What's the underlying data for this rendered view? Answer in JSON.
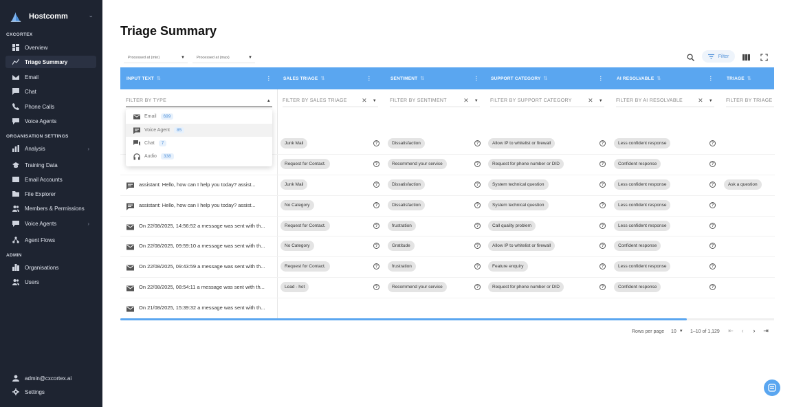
{
  "app": {
    "name": "Hostcomm"
  },
  "sidebar": {
    "sections": {
      "cxcortex": "CXCORTEX",
      "org": "ORGANISATION SETTINGS",
      "admin": "ADMIN"
    },
    "items": [
      {
        "label": "Overview",
        "icon": "dashboard-icon"
      },
      {
        "label": "Triage Summary",
        "icon": "triage-icon"
      },
      {
        "label": "Email",
        "icon": "email-icon"
      },
      {
        "label": "Chat",
        "icon": "chat-icon"
      },
      {
        "label": "Phone Calls",
        "icon": "phone-icon"
      },
      {
        "label": "Voice Agents",
        "icon": "voice-agent-icon"
      },
      {
        "label": "Analysis",
        "icon": "analysis-icon"
      },
      {
        "label": "Training Data",
        "icon": "training-icon"
      },
      {
        "label": "Email Accounts",
        "icon": "email-accounts-icon"
      },
      {
        "label": "File Explorer",
        "icon": "folder-icon"
      },
      {
        "label": "Members & Permissions",
        "icon": "members-icon"
      },
      {
        "label": "Voice Agents",
        "icon": "voice-agent-icon"
      },
      {
        "label": "Agent Flows",
        "icon": "flow-icon"
      },
      {
        "label": "Organisations",
        "icon": "organisation-icon"
      },
      {
        "label": "Users",
        "icon": "users-icon"
      }
    ],
    "account": {
      "email": "admin@cxcortex.ai",
      "settings": "Settings"
    }
  },
  "main": {
    "title": "Triage Summary",
    "range": {
      "min": "Processed at (min)",
      "max": "Processed at (max)"
    },
    "filter_label": "Filter",
    "columns": [
      "INPUT TEXT",
      "SALES TRIAGE",
      "SENTIMENT",
      "SUPPORT CATEGORY",
      "AI RESOLVABLE",
      "TRIAGE"
    ],
    "filters": [
      "FILTER BY TYPE",
      "FILTER BY SALES TRIAGE",
      "FILTER BY SENTIMENT",
      "FILTER BY SUPPORT CATEGORY",
      "FILTER BY AI RESOLVABLE",
      "FILTER BY TRIAGE"
    ],
    "type_options": [
      {
        "label": "Email",
        "count": "699"
      },
      {
        "label": "Voice Agent",
        "count": "85"
      },
      {
        "label": "Chat",
        "count": "7"
      },
      {
        "label": "Audio",
        "count": "338"
      }
    ],
    "rows": [
      {
        "type": "chat",
        "text": "",
        "sales": "Junk Mail",
        "sentiment": "Dissatisfaction",
        "support": "Allow IP to whitelist or firewall",
        "ai": "Less confident response",
        "triage": ""
      },
      {
        "type": "chat",
        "text": "",
        "sales": "Request for Contact.",
        "sentiment": "Recommend your service",
        "support": "Request for phone number or DID",
        "ai": "Confident response",
        "triage": ""
      },
      {
        "type": "chat",
        "text": "assistant: Hello, how can I help you today? assist...",
        "sales": "Junk Mail",
        "sentiment": "Dissatisfaction",
        "support": "System technical question",
        "ai": "Less confident response",
        "triage": "Ask a question"
      },
      {
        "type": "chat",
        "text": "assistant: Hello, how can I help you today? assist...",
        "sales": "No Category",
        "sentiment": "Dissatisfaction",
        "support": "System technical question",
        "ai": "Less confident response",
        "triage": ""
      },
      {
        "type": "email",
        "text": "On 22/08/2025, 14:56:52 a message was sent with th...",
        "sales": "Request for Contact.",
        "sentiment": "frustration",
        "support": "Call quality problem",
        "ai": "Less confident response",
        "triage": ""
      },
      {
        "type": "email",
        "text": "On 22/08/2025, 09:59:10 a message was sent with th...",
        "sales": "No Category",
        "sentiment": "Gratitude",
        "support": "Allow IP to whitelist or firewall",
        "ai": "Confident response",
        "triage": ""
      },
      {
        "type": "email",
        "text": "On 22/08/2025, 09:43:59 a message was sent with th...",
        "sales": "Request for Contact.",
        "sentiment": "frustration",
        "support": "Feature enquiry",
        "ai": "Less confident response",
        "triage": ""
      },
      {
        "type": "email",
        "text": "On 22/08/2025, 08:54:11 a message was sent with th...",
        "sales": "Lead - hot",
        "sentiment": "Recommend your service",
        "support": "Request for phone number or DID",
        "ai": "Confident response",
        "triage": ""
      },
      {
        "type": "email",
        "text": "On 21/08/2025, 15:39:32 a message was sent with th...",
        "sales": "",
        "sentiment": "",
        "support": "",
        "ai": "",
        "triage": ""
      }
    ],
    "footer": {
      "rows_per_page_label": "Rows per page",
      "rows_per_page": "10",
      "range": "1–10 of 1,129"
    }
  }
}
